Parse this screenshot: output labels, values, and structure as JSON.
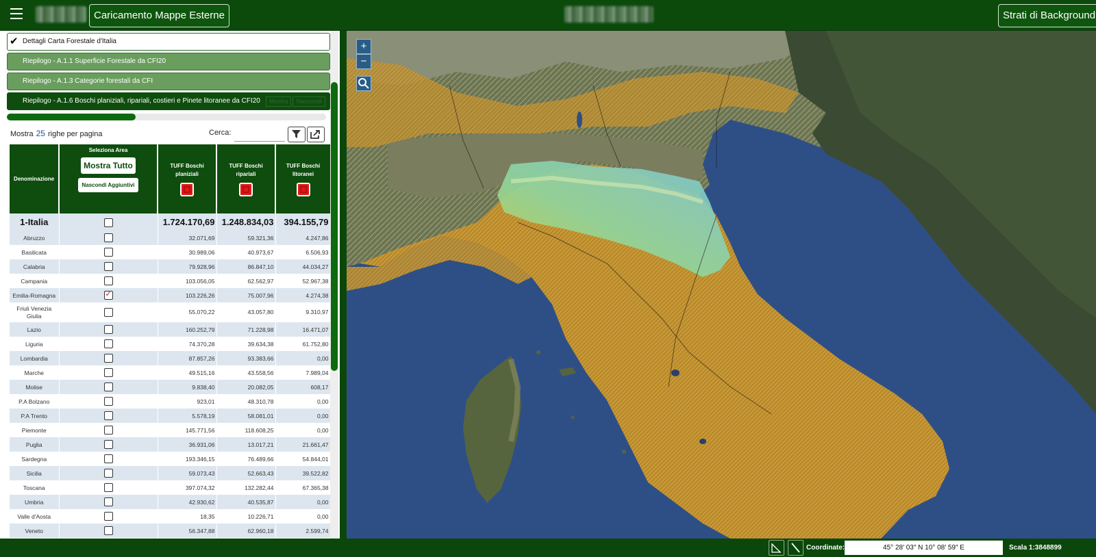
{
  "topbar": {
    "menu_icon": "hamburger-icon",
    "left_button": "Caricamento Mappe Esterne",
    "right_button": "Strati di Background"
  },
  "accordion": [
    {
      "label": "Dettagli Carta Forestale d'Italia",
      "state": "checked"
    },
    {
      "label": "Riepilogo - A.1.1 Superficie Forestale da CFI20"
    },
    {
      "label": "Riepilogo - A.1.3 Categorie forestali da CFI"
    },
    {
      "label": "Riepilogo - A.1.6 Boschi planiziali, ripariali, costieri e Pinete litoranee da CFI20",
      "actions": [
        "Mostra",
        "Nascondi"
      ]
    }
  ],
  "table_controls": {
    "show_prefix": "Mostra",
    "page_size": "25",
    "show_suffix": "righe per pagina",
    "search_label": "Cerca:",
    "search_value": "",
    "filter_icon": "filter-icon",
    "export_icon": "export-icon"
  },
  "table": {
    "headers": {
      "name": "Denominazione",
      "select_area": "Seleziona Area",
      "show_all": "Mostra Tutto",
      "hide_added": "Nascondi Aggiuntivi",
      "col1": "TUFF Boschi planiziali",
      "col2": "TUFF Boschi ripariali",
      "col3": "TUFF Boschi litoranei"
    },
    "total": {
      "name": "1-Italia",
      "v1": "1.724.170,69",
      "v2": "1.248.834,03",
      "v3": "394.155,79"
    },
    "rows": [
      {
        "name": "Abruzzo",
        "checked": false,
        "v1": "32.071,69",
        "v2": "59.321,36",
        "v3": "4.247,86"
      },
      {
        "name": "Basilicata",
        "checked": false,
        "v1": "30.989,06",
        "v2": "40.973,67",
        "v3": "6.506,93"
      },
      {
        "name": "Calabria",
        "checked": false,
        "v1": "79.928,96",
        "v2": "86.847,10",
        "v3": "44.034,27"
      },
      {
        "name": "Campania",
        "checked": false,
        "v1": "103.056,05",
        "v2": "62.562,97",
        "v3": "52.967,38"
      },
      {
        "name": "Emilia-Romagna",
        "checked": true,
        "v1": "103.226,26",
        "v2": "75.007,96",
        "v3": "4.274,38"
      },
      {
        "name": "Friuli Venezia Giulia",
        "checked": false,
        "v1": "55.070,22",
        "v2": "43.057,80",
        "v3": "9.310,97"
      },
      {
        "name": "Lazio",
        "checked": false,
        "v1": "160.252,79",
        "v2": "71.228,98",
        "v3": "16.471,07"
      },
      {
        "name": "Liguria",
        "checked": false,
        "v1": "74.370,28",
        "v2": "39.634,38",
        "v3": "61.752,80"
      },
      {
        "name": "Lombardia",
        "checked": false,
        "v1": "87.857,26",
        "v2": "93.383,66",
        "v3": "0,00"
      },
      {
        "name": "Marche",
        "checked": false,
        "v1": "49.515,16",
        "v2": "43.558,56",
        "v3": "7.989,04"
      },
      {
        "name": "Molise",
        "checked": false,
        "v1": "9.838,40",
        "v2": "20.082,05",
        "v3": "608,17"
      },
      {
        "name": "P.A Bolzano",
        "checked": false,
        "v1": "923,01",
        "v2": "48.310,78",
        "v3": "0,00"
      },
      {
        "name": "P.A Trento",
        "checked": false,
        "v1": "5.578,19",
        "v2": "58.081,01",
        "v3": "0,00"
      },
      {
        "name": "Piemonte",
        "checked": false,
        "v1": "145.771,56",
        "v2": "118.608,25",
        "v3": "0,00"
      },
      {
        "name": "Puglia",
        "checked": false,
        "v1": "36.931,06",
        "v2": "13.017,21",
        "v3": "21.661,47"
      },
      {
        "name": "Sardegna",
        "checked": false,
        "v1": "193.346,15",
        "v2": "76.489,66",
        "v3": "54.844,01"
      },
      {
        "name": "Sicilia",
        "checked": false,
        "v1": "59.073,43",
        "v2": "52.663,43",
        "v3": "39.522,82"
      },
      {
        "name": "Toscana",
        "checked": false,
        "v1": "397.074,32",
        "v2": "132.282,44",
        "v3": "67.365,38"
      },
      {
        "name": "Umbria",
        "checked": false,
        "v1": "42.930,62",
        "v2": "40.535,87",
        "v3": "0,00"
      },
      {
        "name": "Valle d'Aosta",
        "checked": false,
        "v1": "18,35",
        "v2": "10.226,71",
        "v3": "0,00"
      },
      {
        "name": "Veneto",
        "checked": false,
        "v1": "56.347,88",
        "v2": "62.960,18",
        "v3": "2.599,74"
      }
    ]
  },
  "map": {
    "zoom_in": "+",
    "zoom_out": "−",
    "zoom_box_icon": "magnifier-icon"
  },
  "footer": {
    "measure_area_icon": "measure-area-icon",
    "measure_line_icon": "measure-line-icon",
    "coord_label": "Coordinate:",
    "coord_value": "45° 28′ 03″ N 10° 08′ 59″ E",
    "scale_label": "Scala 1:3848899"
  },
  "colors": {
    "header_green": "#0b4a0b",
    "accordion_green": "#6a9e5e",
    "forest_orange": "#c99a2e",
    "sea_blue": "#2b4f8c",
    "highlight_region": "#7fd6a0"
  }
}
